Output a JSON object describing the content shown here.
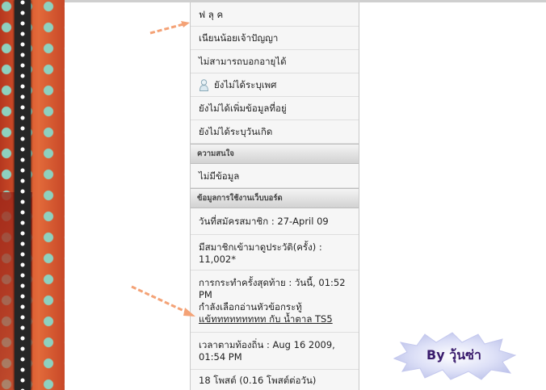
{
  "profile": {
    "name": "ฟ ลุ ค",
    "title": "เนียนน้อยเจ้าปัญญา",
    "location": "ไม่สามารถบอกอายุได้",
    "gender": "ยังไม่ได้ระบุเพศ",
    "address": "ยังไม่ได้เพิ่มข้อมูลที่อยู่",
    "birthday": "ยังไม่ได้ระบุวันเกิด"
  },
  "interests": {
    "header": "ความสนใจ",
    "value": "ไม่มีข้อมูล"
  },
  "board_info": {
    "header": "ข้อมูลการใช้งานเว็บบอร์ด",
    "joined": "วันที่สมัครสมาชิก : 27-April 09",
    "profile_views": "มีสมาชิกเข้ามาดูประวัติ(ครั้ง) : 11,002*",
    "last_action": "การกระทำครั้งสุดท้าย : วันนี้, 01:52 PM",
    "reading_prefix": "กำลังเลือกอ่านหัวข้อกระทู้",
    "reading_topic": "แข้ททททททททท กับ น้ำตาล TS5",
    "local_time": "เวลาตามท้องถิ่น : Aug 16 2009, 01:54 PM",
    "posts": "18 โพสต์ (0.16 โพสต์ต่อวัน)"
  },
  "badge": {
    "text": "By วุ้นซ่า"
  },
  "colors": {
    "arrow": "#f4a276",
    "badge_fill": "#cfd3f2",
    "badge_text": "#3b1d6e",
    "header_gradient_top": "#f4f4f4",
    "header_gradient_bottom": "#d2d2d2"
  }
}
